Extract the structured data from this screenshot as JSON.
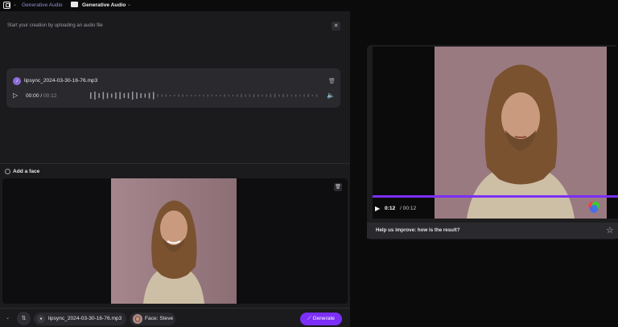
{
  "header": {
    "project": "Generative Audio",
    "folder": "Generative Audio"
  },
  "upload": {
    "hint": "Start your creation by uploading an audio file"
  },
  "audio": {
    "file_name": "lipsync_2024-03-30-16-76.mp3",
    "time_current": "00:00",
    "time_separator": " / ",
    "time_total": "00:12"
  },
  "face_section": {
    "title": "Add a face"
  },
  "bottom_bar": {
    "audio_chip": "lipsync_2024-03-30-16-76.mp3",
    "face_chip": "Face: Steve",
    "generate_label": "Generate"
  },
  "player": {
    "current": "0:12",
    "duration": "/ 00:12",
    "progress": 1.0
  },
  "feedback": {
    "prompt": "Help us improve: how is the result?"
  },
  "colors": {
    "accent": "#7b2ff7",
    "panel": "#1b1b1e",
    "card": "#2a2a2e"
  },
  "icons": [
    "logo-icon",
    "folder-icon",
    "close-icon",
    "audio-file-icon",
    "trash-icon",
    "play-icon",
    "volume-icon",
    "face-icon",
    "swap-icon",
    "mic-icon",
    "wand-icon",
    "color-wheel-icon",
    "star-icon"
  ]
}
